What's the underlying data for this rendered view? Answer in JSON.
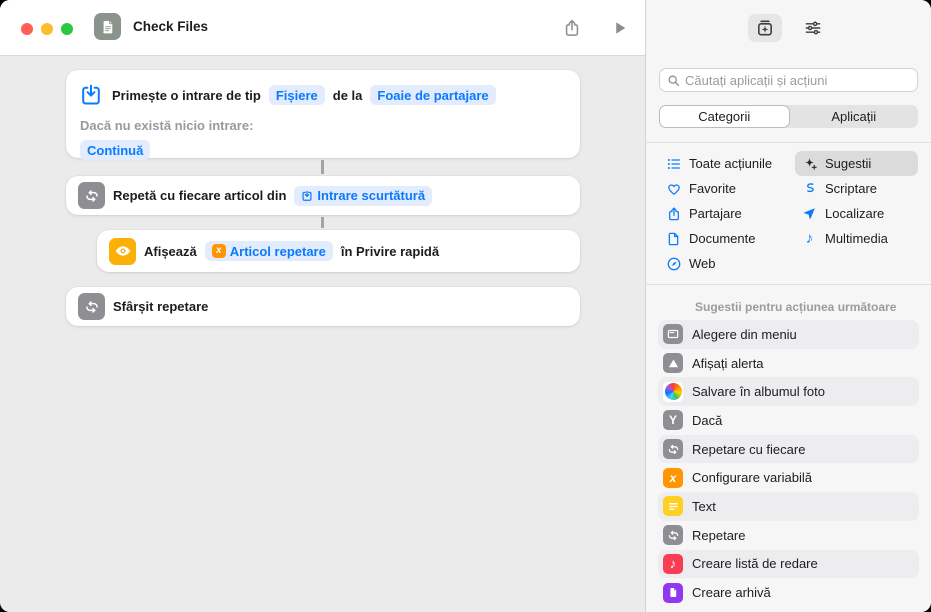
{
  "titlebar": {
    "title": "Check Files"
  },
  "canvas": {
    "block1": {
      "text1": "Primește o intrare de tip",
      "token_type": "Fișiere",
      "text2": "de la",
      "token_source": "Foaie de partajare",
      "fallback_label": "Dacă nu există nicio intrare:",
      "fallback_token": "Continuă"
    },
    "block2": {
      "text": "Repetă cu fiecare articol din",
      "token": "Intrare scurtătură"
    },
    "block3": {
      "text1": "Afișează",
      "token": "Articol repetare",
      "text2": "în Privire rapidă"
    },
    "block4": {
      "text": "Sfârșit repetare"
    }
  },
  "sidebar": {
    "search": {
      "placeholder": "Căutați aplicații și acțiuni"
    },
    "tabs": [
      {
        "label": "Categorii",
        "selected": true
      },
      {
        "label": "Aplicații",
        "selected": false
      }
    ],
    "categories": [
      {
        "label": "Toate acțiunile",
        "icon": "list-icon"
      },
      {
        "label": "Favorite",
        "icon": "heart-icon"
      },
      {
        "label": "Partajare",
        "icon": "share-icon"
      },
      {
        "label": "Documente",
        "icon": "document-icon"
      },
      {
        "label": "Web",
        "icon": "compass-icon"
      },
      {
        "label": "Sugestii",
        "icon": "sparkles-icon",
        "selected": true
      },
      {
        "label": "Scriptare",
        "icon": "script-scroll-icon"
      },
      {
        "label": "Localizare",
        "icon": "location-arrow-icon"
      },
      {
        "label": "Multimedia",
        "icon": "music-note-icon"
      }
    ],
    "suggestions_header": "Sugestii pentru acțiunea următoare",
    "suggestions": [
      {
        "label": "Alegere din meniu",
        "icon": "menu-icon",
        "color": "#8e8e93"
      },
      {
        "label": "Afișați alerta",
        "icon": "alert-icon",
        "color": "#8e8e93"
      },
      {
        "label": "Salvare în albumul foto",
        "icon": "photos-icon",
        "color": "#ffffff"
      },
      {
        "label": "Dacă",
        "icon": "if-icon",
        "color": "#8e8e93"
      },
      {
        "label": "Repetare cu fiecare",
        "icon": "repeat-icon",
        "color": "#8e8e93"
      },
      {
        "label": "Configurare variabilă",
        "icon": "variable-icon",
        "color": "#ff9500"
      },
      {
        "label": "Text",
        "icon": "text-icon",
        "color": "#fdd023"
      },
      {
        "label": "Repetare",
        "icon": "repeat-icon",
        "color": "#8e8e93"
      },
      {
        "label": "Creare listă de redare",
        "icon": "playlist-icon",
        "color": "#fa3d55"
      },
      {
        "label": "Creare arhivă",
        "icon": "archive-icon",
        "color": "#9137f2"
      }
    ]
  },
  "colors": {
    "accent_blue": "#0a7aff",
    "token_background": "#e2ecfc",
    "action_gray": "#8e8e93",
    "quick_look_yellow": "#fab005",
    "variable_orange": "#ff9500",
    "traffic_red": "#ff5f57",
    "traffic_yellow": "#febc2e",
    "traffic_green": "#28c840"
  }
}
